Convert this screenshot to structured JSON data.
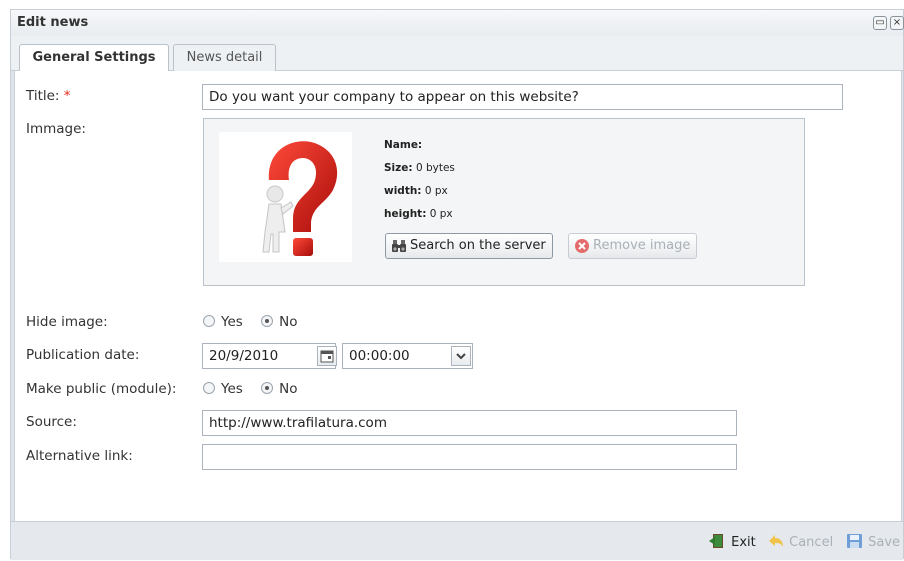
{
  "window": {
    "title": "Edit news"
  },
  "tabs": [
    {
      "label": "General Settings"
    },
    {
      "label": "News detail"
    }
  ],
  "form": {
    "title_label": "Title:",
    "required_mark": "*",
    "title_value": "Do you want your company to appear on this website?",
    "image_label": "Immage:",
    "image_meta": {
      "name_label": "Name:",
      "name_value": "",
      "size_label": "Size:",
      "size_value": "0 bytes",
      "width_label": "width:",
      "width_value": "0 px",
      "height_label": "height:",
      "height_value": "0 px"
    },
    "search_server_label": "Search on the server",
    "remove_image_label": "Remove image",
    "hide_image_label": "Hide image:",
    "hide_image_options": [
      "Yes",
      "No"
    ],
    "hide_image_selected": "No",
    "publication_date_label": "Publication date:",
    "publication_date_value": "20/9/2010",
    "publication_time_value": "00:00:00",
    "make_public_label": "Make public (module):",
    "make_public_options": [
      "Yes",
      "No"
    ],
    "make_public_selected": "No",
    "source_label": "Source:",
    "source_value": "http://www.trafilatura.com",
    "alt_link_label": "Alternative link:",
    "alt_link_value": ""
  },
  "footer": {
    "exit_label": "Exit",
    "cancel_label": "Cancel",
    "save_label": "Save"
  },
  "colors": {
    "required": "#e0291c",
    "window_bg": "#dfe4ea",
    "image_box_bg": "#f4f5f6"
  }
}
